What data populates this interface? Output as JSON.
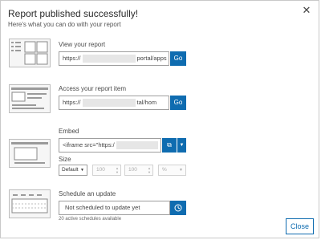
{
  "dialog": {
    "title": "Report published successfully!",
    "subtitle": "Here's what you can do with your report",
    "close_icon": "close-icon",
    "close_label": "Close"
  },
  "view_report": {
    "label": "View your report",
    "url_prefix": "https://",
    "url_suffix": "portal/apps",
    "go_label": "Go"
  },
  "access_item": {
    "label": "Access your report item",
    "url_prefix": "https://",
    "url_suffix": "tal/hom",
    "go_label": "Go"
  },
  "embed": {
    "label": "Embed",
    "code_prefix": "<iframe src=\"https:/",
    "copy_icon": "copy-icon",
    "dropdown_icon": "chevron-down-icon",
    "size_label": "Size",
    "size_selected": "Default",
    "width_value": "100",
    "height_value": "100",
    "unit_selected": "%"
  },
  "schedule": {
    "label": "Schedule an update",
    "status": "Not scheduled to update yet",
    "clock_icon": "clock-icon",
    "note": "20 active schedules available"
  },
  "colors": {
    "accent": "#0f6cb0",
    "border": "#9e9e9e"
  }
}
